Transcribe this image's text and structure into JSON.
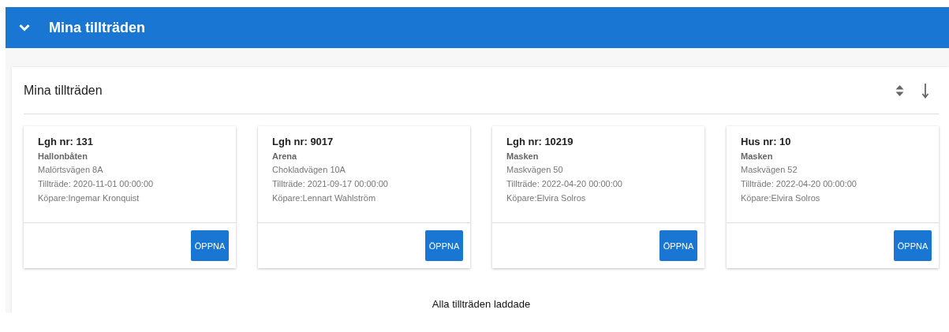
{
  "header": {
    "title": "Mina tillträden",
    "expanded": true
  },
  "panel": {
    "title": "Mina tillträden"
  },
  "cards": [
    {
      "title": "Lgh nr: 131",
      "name": "Hallonbåten",
      "address": "Malörtsvägen 8A",
      "access": "Tillträde: 2020-11-01 00:00:00",
      "buyer": "Köpare:Ingemar Kronquist",
      "button": "ÖPPNA"
    },
    {
      "title": "Lgh nr: 9017",
      "name": "Arena",
      "address": "Chokladvägen 10A",
      "access": "Tillträde: 2021-09-17 00:00:00",
      "buyer": "Köpare:Lennart Wahlström",
      "button": "ÖPPNA"
    },
    {
      "title": "Lgh nr: 10219",
      "name": "Masken",
      "address": "Maskvägen 50",
      "access": "Tillträde: 2022-04-20 00:00:00",
      "buyer": "Köpare:Elvira Solros",
      "button": "ÖPPNA"
    },
    {
      "title": "Hus nr: 10",
      "name": "Masken",
      "address": "Maskvägen 52",
      "access": "Tillträde: 2022-04-20 00:00:00",
      "buyer": "Köpare:Elvira Solros",
      "button": "ÖPPNA"
    }
  ],
  "status": "Alla tillträden laddade"
}
